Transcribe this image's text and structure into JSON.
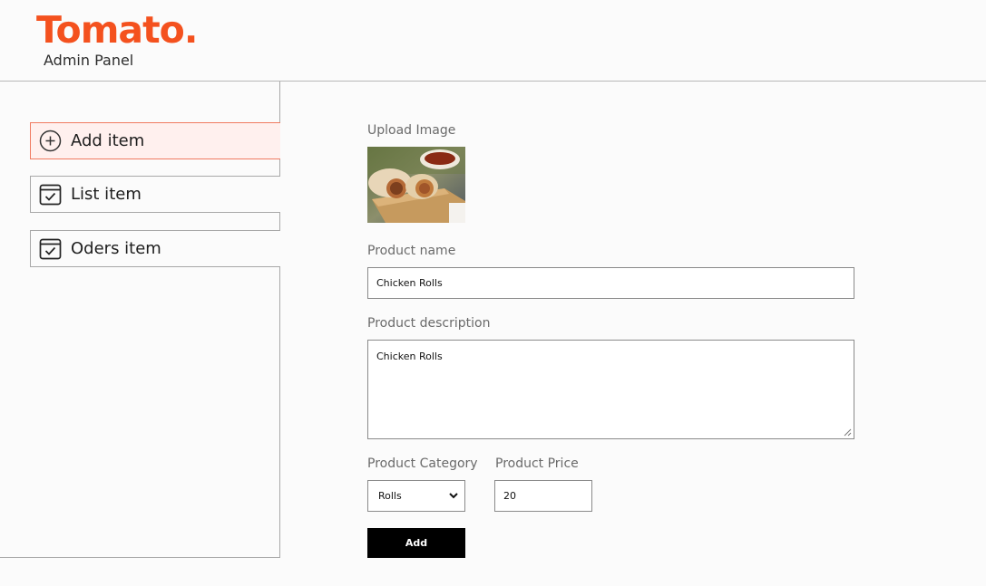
{
  "header": {
    "logo": "Tomato.",
    "subtitle": "Admin Panel"
  },
  "sidebar": {
    "items": [
      {
        "label": "Add item",
        "icon": "add-circle-icon",
        "active": true
      },
      {
        "label": "List item",
        "icon": "calendar-check-icon",
        "active": false
      },
      {
        "label": "Oders item",
        "icon": "calendar-check-icon",
        "active": false
      }
    ]
  },
  "form": {
    "upload_label": "Upload Image",
    "name_label": "Product name",
    "name_value": "Chicken Rolls",
    "description_label": "Product description",
    "description_value": "Chicken Rolls",
    "category_label": "Product Category",
    "category_value": "Rolls",
    "price_label": "Product Price",
    "price_value": "20",
    "submit_label": "Add"
  },
  "colors": {
    "brand": "#f4511e",
    "active_bg": "#fff0ee",
    "active_border": "#f07a60",
    "button_bg": "#000000"
  }
}
